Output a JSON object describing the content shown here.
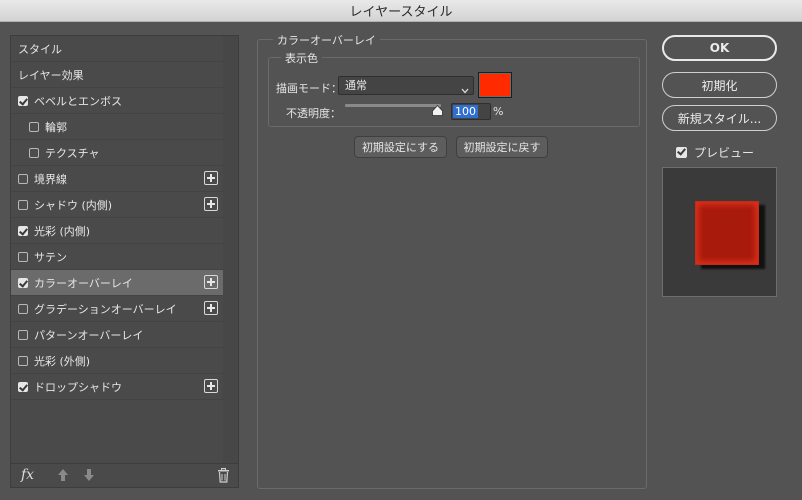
{
  "window": {
    "title": "レイヤースタイル"
  },
  "sidebar": {
    "items": [
      {
        "label": "スタイル",
        "has_checkbox": false,
        "checked": false,
        "plus": false,
        "indent": 0,
        "selected": false
      },
      {
        "label": "レイヤー効果",
        "has_checkbox": false,
        "checked": false,
        "plus": false,
        "indent": 0,
        "selected": false
      },
      {
        "label": "ベベルとエンボス",
        "has_checkbox": true,
        "checked": true,
        "plus": false,
        "indent": 0,
        "selected": false
      },
      {
        "label": "輪郭",
        "has_checkbox": true,
        "checked": false,
        "plus": false,
        "indent": 1,
        "selected": false
      },
      {
        "label": "テクスチャ",
        "has_checkbox": true,
        "checked": false,
        "plus": false,
        "indent": 1,
        "selected": false
      },
      {
        "label": "境界線",
        "has_checkbox": true,
        "checked": false,
        "plus": true,
        "indent": 0,
        "selected": false
      },
      {
        "label": "シャドウ (内側)",
        "has_checkbox": true,
        "checked": false,
        "plus": true,
        "indent": 0,
        "selected": false
      },
      {
        "label": "光彩 (内側)",
        "has_checkbox": true,
        "checked": true,
        "plus": false,
        "indent": 0,
        "selected": false
      },
      {
        "label": "サテン",
        "has_checkbox": true,
        "checked": false,
        "plus": false,
        "indent": 0,
        "selected": false
      },
      {
        "label": "カラーオーバーレイ",
        "has_checkbox": true,
        "checked": true,
        "plus": true,
        "indent": 0,
        "selected": true
      },
      {
        "label": "グラデーションオーバーレイ",
        "has_checkbox": true,
        "checked": false,
        "plus": true,
        "indent": 0,
        "selected": false
      },
      {
        "label": "パターンオーバーレイ",
        "has_checkbox": true,
        "checked": false,
        "plus": false,
        "indent": 0,
        "selected": false
      },
      {
        "label": "光彩 (外側)",
        "has_checkbox": true,
        "checked": false,
        "plus": false,
        "indent": 0,
        "selected": false
      },
      {
        "label": "ドロップシャドウ",
        "has_checkbox": true,
        "checked": true,
        "plus": true,
        "indent": 0,
        "selected": false
      }
    ],
    "footer": {
      "fx_label": "fx",
      "move_up_icon": "arrow-up-icon",
      "move_down_icon": "arrow-down-icon",
      "delete_icon": "trash-icon"
    }
  },
  "panel": {
    "section_title": "カラーオーバーレイ",
    "group_title": "表示色",
    "blend_mode_label": "描画モード：",
    "blend_mode_value": "通常",
    "overlay_color": "#ff2a00",
    "opacity_label": "不透明度：",
    "opacity_value": "100",
    "opacity_unit": "%",
    "opacity_fraction": 1.0,
    "make_default_button": "初期設定にする",
    "reset_default_button": "初期設定に戻す"
  },
  "actions": {
    "ok": "OK",
    "reset": "初期化",
    "new_style": "新規スタイル...",
    "preview_label": "プレビュー",
    "preview_checked": true
  },
  "colors": {
    "dialog_bg": "#535353",
    "selected_row": "#6b6b6b",
    "preview_fill": "#a81a0c",
    "selection_highlight": "#2f6fcf"
  }
}
